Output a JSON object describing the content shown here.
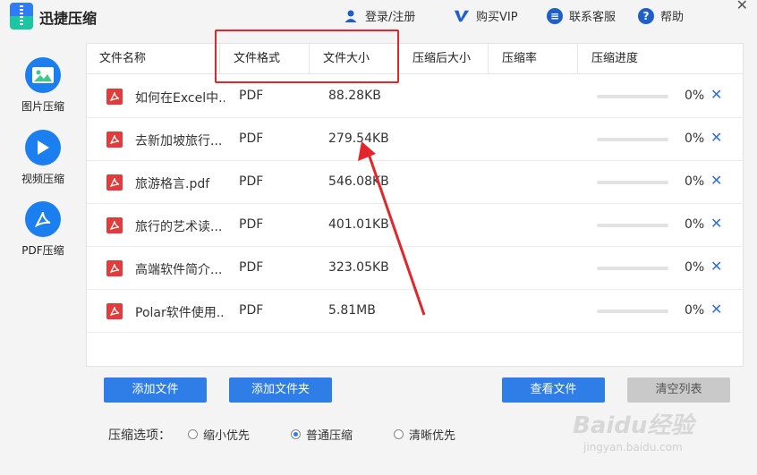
{
  "app": {
    "title": "迅捷压缩"
  },
  "topnav": {
    "login": "登录/注册",
    "vip": "购买VIP",
    "service": "联系客服",
    "help": "帮助"
  },
  "sidebar": {
    "items": [
      {
        "label": "图片压缩",
        "icon": "image-icon"
      },
      {
        "label": "视频压缩",
        "icon": "play-icon"
      },
      {
        "label": "PDF压缩",
        "icon": "pdf-icon"
      }
    ]
  },
  "table": {
    "headers": [
      "文件名称",
      "文件格式",
      "文件大小",
      "压缩后大小",
      "压缩率",
      "压缩进度"
    ],
    "rows": [
      {
        "name": "如何在Excel中..",
        "format": "PDF",
        "size": "88.28KB",
        "progress": "0%",
        "progress_value": 0
      },
      {
        "name": "去新加坡旅行...",
        "format": "PDF",
        "size": "279.54KB",
        "progress": "0%",
        "progress_value": 0
      },
      {
        "name": "旅游格言.pdf",
        "format": "PDF",
        "size": "546.08KB",
        "progress": "0%",
        "progress_value": 0
      },
      {
        "name": "旅行的艺术读...",
        "format": "PDF",
        "size": "401.01KB",
        "progress": "0%",
        "progress_value": 0
      },
      {
        "name": "高端软件简介...",
        "format": "PDF",
        "size": "323.05KB",
        "progress": "0%",
        "progress_value": 0
      },
      {
        "name": "Polar软件使用..",
        "format": "PDF",
        "size": "5.81MB",
        "progress": "0%",
        "progress_value": 0
      }
    ],
    "delete_glyph": "✕"
  },
  "buttons": {
    "add_file": "添加文件",
    "add_folder": "添加文件夹",
    "view_files": "查看文件",
    "clear_list": "清空列表"
  },
  "options": {
    "label": "压缩选项：",
    "choices": [
      "缩小优先",
      "普通压缩",
      "清晰优先"
    ],
    "selected": "普通压缩"
  },
  "watermark": {
    "main": "Baidu经验",
    "sub": "jingyan.baidu.com"
  },
  "colors": {
    "accent": "#2f7de6",
    "annotation": "#e4262a",
    "pdf_red": "#e23b3b"
  }
}
